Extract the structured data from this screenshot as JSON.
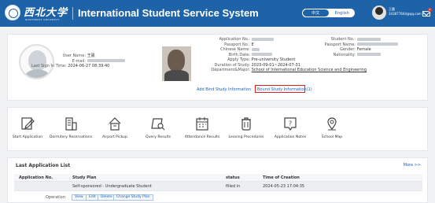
{
  "header": {
    "logo_cn": "西北大学",
    "logo_en": "NORTHWEST UNIVERSITY",
    "title": "International Student Service System",
    "lang_cn": "中文",
    "lang_en": "English",
    "user_name": "王晨",
    "user_email": "343877664@qq.com",
    "caret": "▾",
    "mail_badge": "4"
  },
  "profile": {
    "user_name_label": "User Name:",
    "user_name_value": "王晨",
    "email_label": "E-mail:",
    "last_sign_label": "Last Sign In Time:",
    "last_sign_value": "2024-06-27 08:39:40"
  },
  "application": {
    "app_no_label": "Application No.:",
    "passport_no_label": "Passport No.:",
    "passport_no_value": "E",
    "chinese_name_label": "Chinese Name:",
    "birth_date_label": "Birth Date:",
    "apply_type_label": "Apply Type:",
    "apply_type_value": "Pre-university Student",
    "duration_label": "Duration of Study:",
    "duration_value": "2023-09-01~2024-07-31",
    "dept_label": "Department&Major:",
    "dept_value": "School of International Education  Science and Engineering",
    "student_no_label": "Student No.:",
    "passport_name_label": "Passport Name:",
    "gender_label": "Gender:",
    "gender_value": "Female",
    "nationality_label": "Nationality:",
    "add_bind_link": "Add Bind Study Information",
    "bound_link": "Bound Study Information(1)"
  },
  "menu": [
    {
      "label": "Start Application",
      "icon": "edit-icon"
    },
    {
      "label": "Dormitory Reservations",
      "icon": "building-icon"
    },
    {
      "label": "Airport Pickup",
      "icon": "airport-icon"
    },
    {
      "label": "Query Results",
      "icon": "search-doc-icon"
    },
    {
      "label": "Attendance Results",
      "icon": "calendar-icon"
    },
    {
      "label": "Leaving Procedures",
      "icon": "trash-icon"
    },
    {
      "label": "Application Notes",
      "icon": "help-icon"
    },
    {
      "label": "School Map",
      "icon": "map-pin-icon"
    }
  ],
  "list": {
    "title": "Last Application List",
    "more": "More >>",
    "columns": [
      "Application No.",
      "Study Plan",
      "status",
      "Time of Creation"
    ],
    "rows": [
      {
        "app_no": "",
        "plan": "Self-sponsored - Undergraduate Student",
        "status": "filled in",
        "time": "2024-05-23 17:04:35"
      }
    ],
    "operation_label": "Operation",
    "buttons": [
      "View",
      "Edit",
      "Delete",
      "Change Study Plan"
    ]
  },
  "colors": {
    "header_bg": "#1e63a8",
    "link": "#1a5fb4",
    "highlight_border": "#e02020"
  }
}
